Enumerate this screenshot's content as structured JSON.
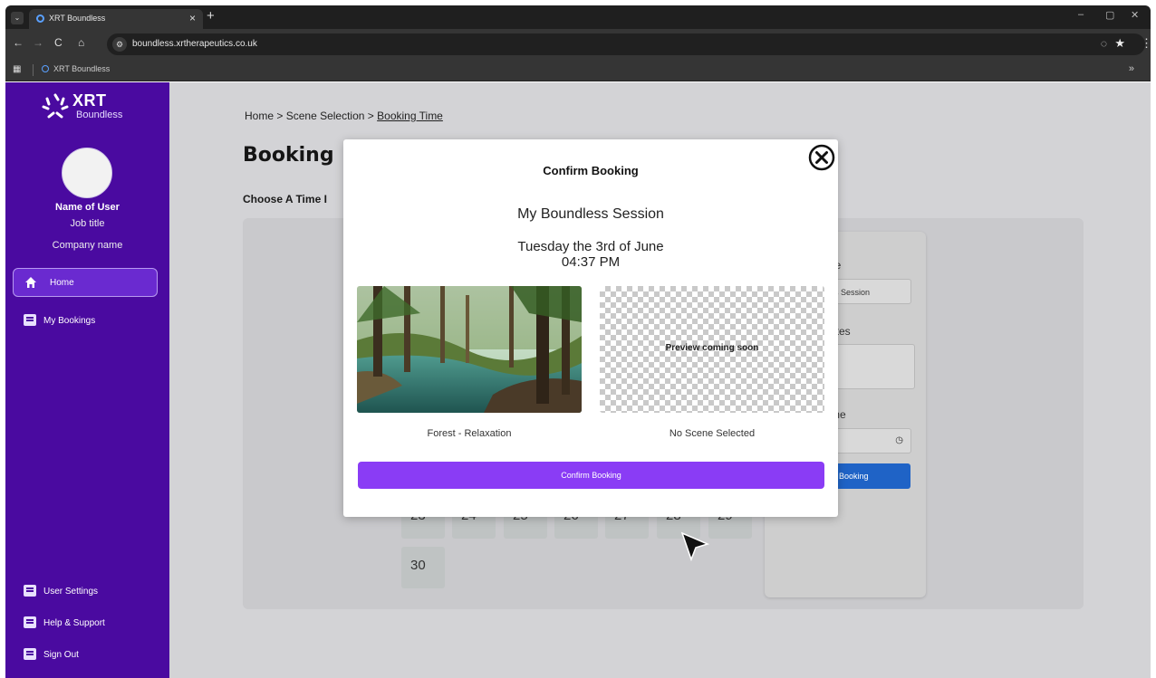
{
  "browser": {
    "tab_title": "XRT Boundless",
    "new_tab_label": "+",
    "close_tab_label": "×",
    "url": "boundless.xrtherapeutics.co.uk",
    "bookmark_label": "XRT Boundless",
    "bookmarks_more": "»",
    "back_label": "←",
    "forward_label": "→",
    "reload_label": "C",
    "home_label": "⌂",
    "minimize_label": "–",
    "restore_label": "▢",
    "close_label": "✕"
  },
  "sidebar": {
    "brand": "XRT",
    "brand_sub": "Boundless",
    "user_name": "Name of User",
    "job_title": "Job title",
    "company": "Company name",
    "nav": [
      {
        "label": "Home"
      },
      {
        "label": "My Bookings"
      }
    ],
    "bottom": [
      {
        "label": "User Settings"
      },
      {
        "label": "Help & Support"
      },
      {
        "label": "Sign Out"
      }
    ]
  },
  "main": {
    "breadcrumb": {
      "home": "Home",
      "sep": ">",
      "scene": "Scene Selection",
      "current": "Booking Time"
    },
    "title": "Booking",
    "choose_label": "Choose A Time I",
    "calendar_row": [
      "23",
      "24",
      "25",
      "26",
      "27",
      "28",
      "29"
    ],
    "calendar_last": "30",
    "form": {
      "title_label": "le",
      "title_value": "s Session",
      "notes_label": "otes",
      "time_label": "me",
      "button_label": "Booking"
    }
  },
  "modal": {
    "title": "Confirm Booking",
    "session_name": "My Boundless Session",
    "date": "Tuesday the 3rd of June",
    "time": "04:37 PM",
    "scene_left_caption": "Forest - Relaxation",
    "scene_right_caption": "No Scene Selected",
    "preview_text": "Preview coming soon",
    "confirm_label": "Confirm Booking"
  }
}
